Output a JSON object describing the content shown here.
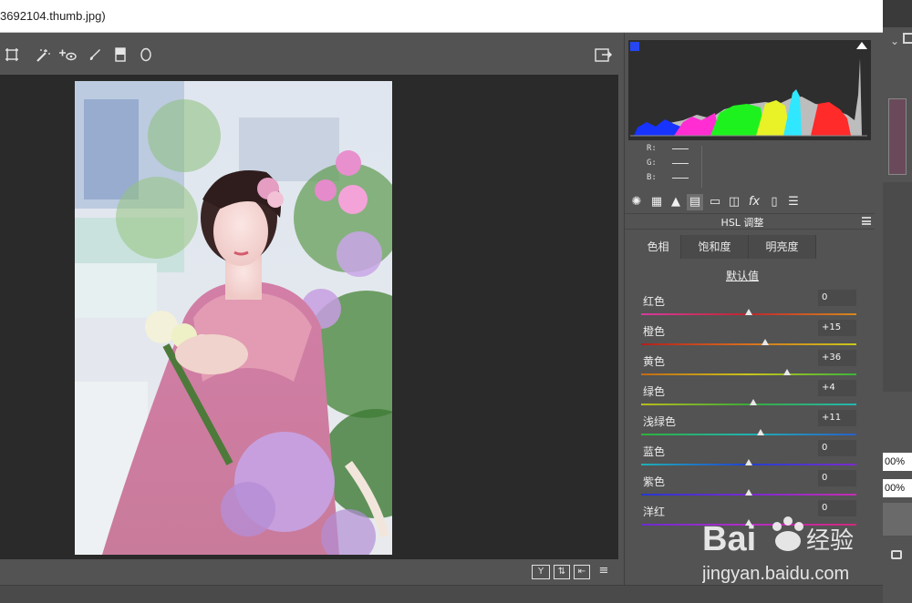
{
  "window": {
    "title": "3692104.thumb.jpg)"
  },
  "toolbar": {
    "tools": [
      "transform-icon",
      "spot-removal-icon",
      "red-eye-icon",
      "brush-icon",
      "graduated-filter-icon",
      "radial-filter-icon"
    ],
    "export_icon": "open-in-new-icon"
  },
  "status": {
    "buttons": [
      "Y",
      "before-after-toggle-icon",
      "swap-icon",
      "settings-icon"
    ]
  },
  "readout": {
    "r_label": "R:",
    "g_label": "G:",
    "b_label": "B:",
    "r_value": "——",
    "g_value": "——",
    "b_value": "——"
  },
  "panel": {
    "title": "HSL 调整",
    "tabs": [
      "色相",
      "饱和度",
      "明亮度"
    ],
    "default_label": "默认值",
    "icons": [
      "aperture-icon",
      "grid-icon",
      "mountain-icon",
      "hsl-icon",
      "split-tone-icon",
      "lens-icon",
      "fx-icon",
      "camera-calibration-icon",
      "presets-icon"
    ]
  },
  "sliders": [
    {
      "label": "红色",
      "value": "0",
      "position": 0.5
    },
    {
      "label": "橙色",
      "value": "+15",
      "position": 0.575
    },
    {
      "label": "黄色",
      "value": "+36",
      "position": 0.68
    },
    {
      "label": "绿色",
      "value": "+4",
      "position": 0.52
    },
    {
      "label": "浅绿色",
      "value": "+11",
      "position": 0.555
    },
    {
      "label": "蓝色",
      "value": "0",
      "position": 0.5
    },
    {
      "label": "紫色",
      "value": "0",
      "position": 0.5
    },
    {
      "label": "洋红",
      "value": "0",
      "position": 0.5
    }
  ],
  "background_app": {
    "zoom_1": "00%",
    "zoom_2": "00%"
  },
  "watermark": {
    "brand": "Bai",
    "brand2": "经验",
    "url": "jingyan.baidu.com"
  },
  "colors": {
    "panel_bg": "#535353",
    "canvas_bg": "#2a2a2a"
  }
}
